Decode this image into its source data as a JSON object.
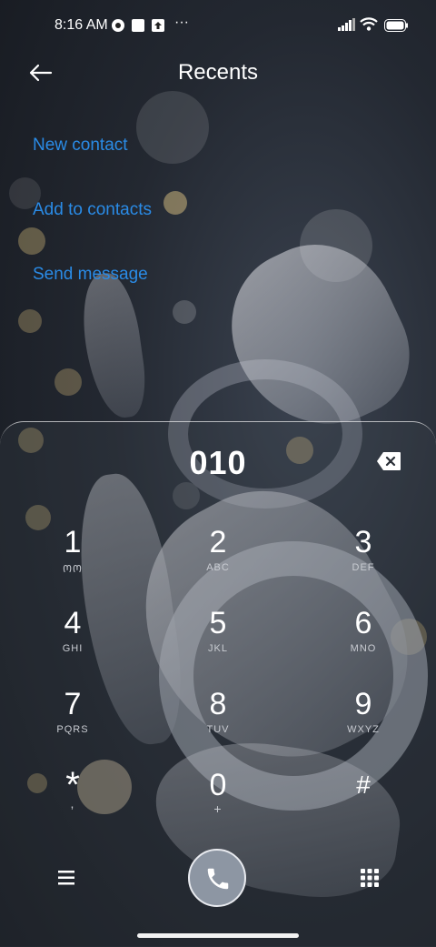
{
  "status_bar": {
    "time": "8:16 AM",
    "more": "···"
  },
  "header": {
    "title": "Recents"
  },
  "actions": {
    "new_contact": "New contact",
    "add_to_contacts": "Add to contacts",
    "send_message": "Send message"
  },
  "dialer": {
    "number": "010",
    "keys": [
      {
        "digit": "1",
        "letters": "ᲝᲝ"
      },
      {
        "digit": "2",
        "letters": "ABC"
      },
      {
        "digit": "3",
        "letters": "DEF"
      },
      {
        "digit": "4",
        "letters": "GHI"
      },
      {
        "digit": "5",
        "letters": "JKL"
      },
      {
        "digit": "6",
        "letters": "MNO"
      },
      {
        "digit": "7",
        "letters": "PQRS"
      },
      {
        "digit": "8",
        "letters": "TUV"
      },
      {
        "digit": "9",
        "letters": "WXYZ"
      },
      {
        "digit": "*",
        "letters": ","
      },
      {
        "digit": "0",
        "letters": "+"
      },
      {
        "digit": "#",
        "letters": ""
      }
    ]
  },
  "colors": {
    "accent": "#2a8be6",
    "call_button": "#8d96a3"
  },
  "icons": [
    "back-arrow-icon",
    "backspace-icon",
    "menu-icon",
    "phone-icon",
    "dialpad-icon",
    "signal-icon",
    "wifi-icon",
    "battery-icon"
  ]
}
